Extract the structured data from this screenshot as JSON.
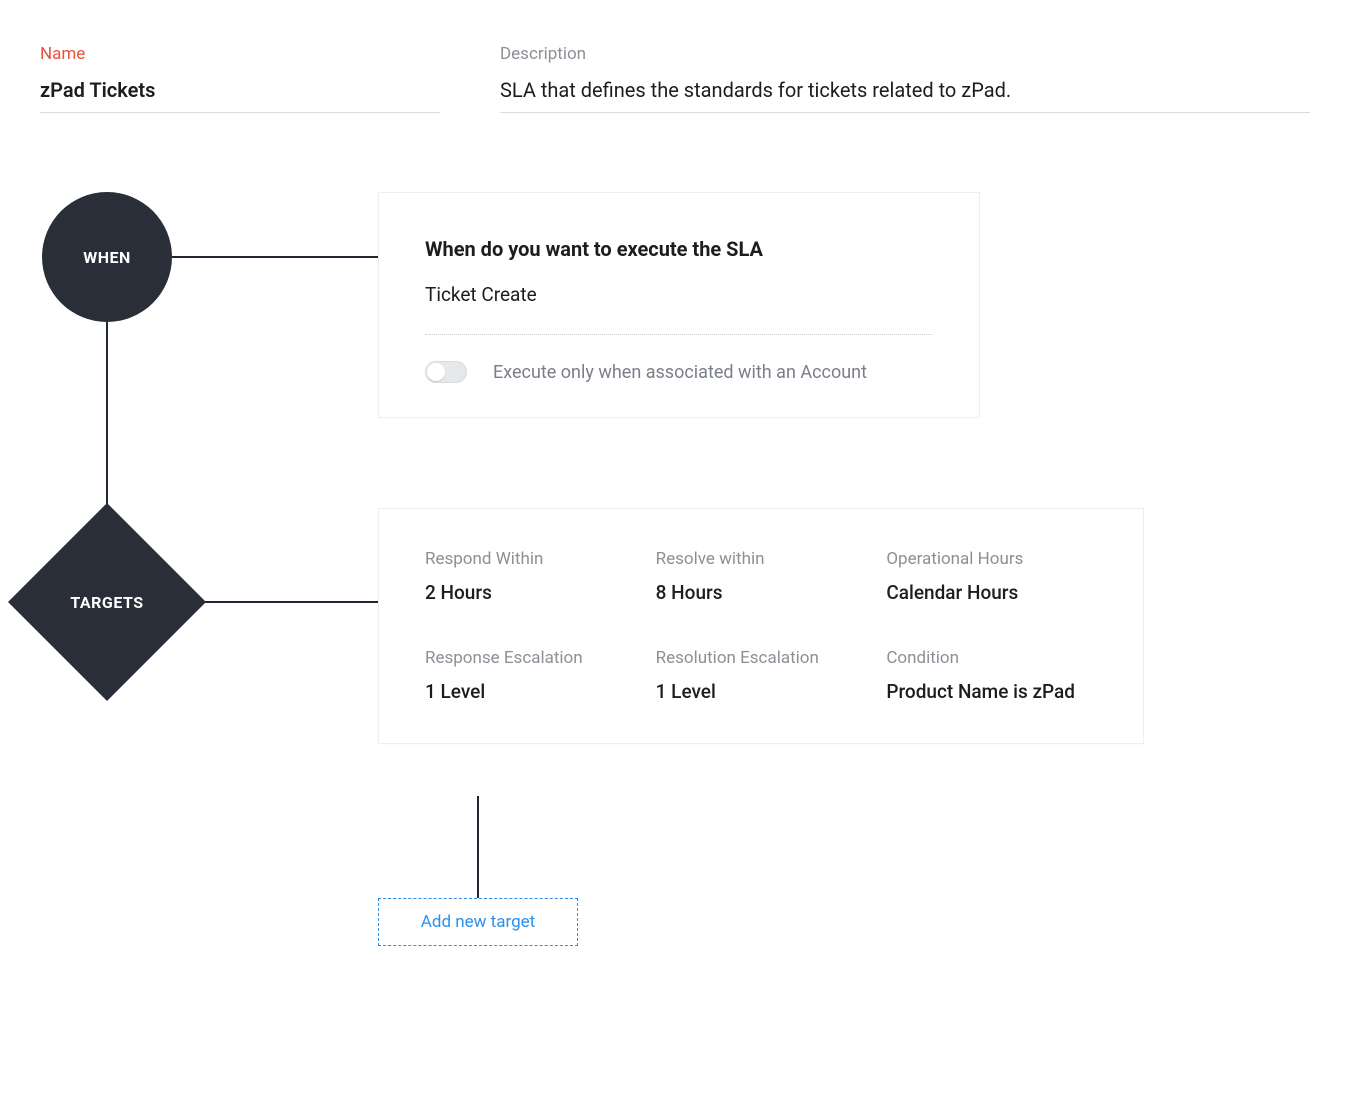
{
  "header": {
    "name_label": "Name",
    "name_value": "zPad Tickets",
    "description_label": "Description",
    "description_value": "SLA that defines the standards for tickets related to zPad."
  },
  "when": {
    "node_label": "WHEN",
    "title": "When do you want to execute the SLA",
    "trigger": "Ticket Create",
    "toggle_label": "Execute only when associated with an Account",
    "toggle_on": false
  },
  "targets": {
    "node_label": "TARGETS",
    "items": {
      "respond_within_label": "Respond Within",
      "respond_within_value": "2 Hours",
      "resolve_within_label": "Resolve within",
      "resolve_within_value": "8 Hours",
      "operational_hours_label": "Operational Hours",
      "operational_hours_value": "Calendar Hours",
      "response_escalation_label": "Response Escalation",
      "response_escalation_value": "1 Level",
      "resolution_escalation_label": "Resolution Escalation",
      "resolution_escalation_value": "1 Level",
      "condition_label": "Condition",
      "condition_value": "Product Name is zPad"
    },
    "add_new_label": "Add new target"
  }
}
